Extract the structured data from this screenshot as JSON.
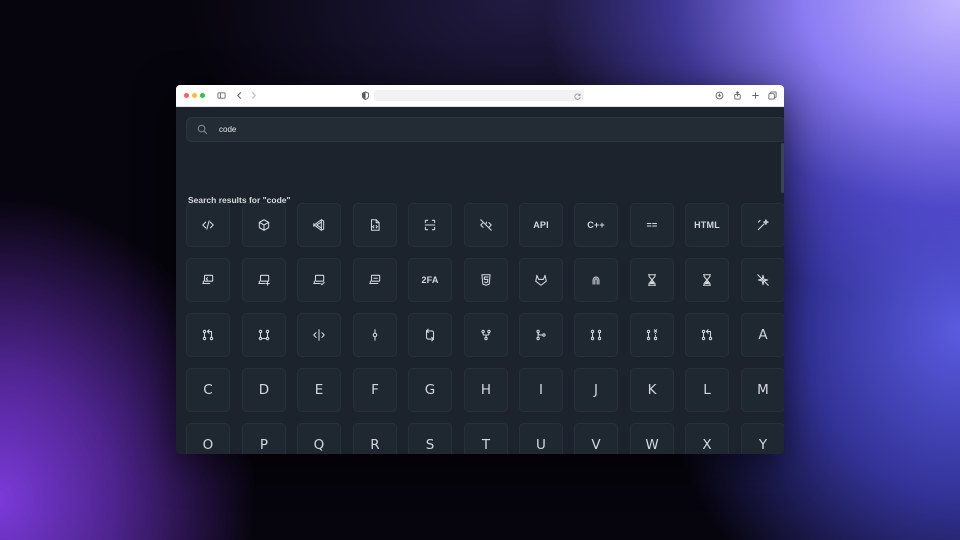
{
  "search": {
    "value": "code"
  },
  "results_title": "Search results for \"code\"",
  "rows": [
    [
      {
        "name": "code-icon",
        "icon": "code"
      },
      {
        "name": "cube-code-icon",
        "icon": "cube"
      },
      {
        "name": "vscode-icon",
        "icon": "vscode"
      },
      {
        "name": "file-code-icon",
        "icon": "file"
      },
      {
        "name": "scan-code-icon",
        "icon": "scan"
      },
      {
        "name": "code-off-icon",
        "icon": "codeoff"
      },
      {
        "name": "api-icon",
        "text": "API"
      },
      {
        "name": "cplusplus-icon",
        "text": "C++"
      },
      {
        "name": "equal-double-icon",
        "text": "=="
      },
      {
        "name": "html-icon",
        "text": "HTML"
      },
      {
        "name": "wand-sparkle-icon",
        "icon": "wand"
      }
    ],
    [
      {
        "name": "device-code-icon",
        "icon": "laptop"
      },
      {
        "name": "device-code-plus-icon",
        "icon": "laptop2"
      },
      {
        "name": "device-code-check-icon",
        "icon": "laptop3"
      },
      {
        "name": "device-code-alt-icon",
        "icon": "laptop4"
      },
      {
        "name": "2fa-icon",
        "text": "2FA"
      },
      {
        "name": "brand-html5-icon",
        "icon": "html5"
      },
      {
        "name": "brand-gitlab-icon",
        "icon": "gitlab"
      },
      {
        "name": "brand-openai-icon",
        "icon": "open"
      },
      {
        "name": "hourglass-icon",
        "icon": "hourglass"
      },
      {
        "name": "hourglass-alt-icon",
        "icon": "hourglass"
      },
      {
        "name": "sparkle-off-icon",
        "icon": "sparkoff"
      }
    ],
    [
      {
        "name": "git-pull-request-icon",
        "icon": "gitpr"
      },
      {
        "name": "git-compare-icon",
        "icon": "gitpr2"
      },
      {
        "name": "source-code-icon",
        "icon": "srccode"
      },
      {
        "name": "git-commit-icon",
        "icon": "commit"
      },
      {
        "name": "git-branch-swap-icon",
        "icon": "swap"
      },
      {
        "name": "git-fork-icon",
        "icon": "fork"
      },
      {
        "name": "git-merge-icon",
        "icon": "merge"
      },
      {
        "name": "git-pull-request-draft-icon",
        "icon": "prdraft"
      },
      {
        "name": "git-pull-request-closed-icon",
        "icon": "prclosed"
      },
      {
        "name": "git-cherry-pick-icon",
        "icon": "cherry"
      },
      {
        "name": "letter-a-icon",
        "letter": "A"
      }
    ],
    [
      {
        "name": "letter-c-icon",
        "letter": "C"
      },
      {
        "name": "letter-d-icon",
        "letter": "D"
      },
      {
        "name": "letter-e-icon",
        "letter": "E"
      },
      {
        "name": "letter-f-icon",
        "letter": "F"
      },
      {
        "name": "letter-g-icon",
        "letter": "G"
      },
      {
        "name": "letter-h-icon",
        "letter": "H"
      },
      {
        "name": "letter-i-icon",
        "letter": "I"
      },
      {
        "name": "letter-j-icon",
        "letter": "J"
      },
      {
        "name": "letter-k-icon",
        "letter": "K"
      },
      {
        "name": "letter-l-icon",
        "letter": "L"
      },
      {
        "name": "letter-m-icon",
        "letter": "M"
      }
    ],
    [
      {
        "name": "letter-o-icon",
        "letter": "O"
      },
      {
        "name": "letter-p-icon",
        "letter": "P"
      },
      {
        "name": "letter-q-icon",
        "letter": "Q"
      },
      {
        "name": "letter-r-icon",
        "letter": "R"
      },
      {
        "name": "letter-s-icon",
        "letter": "S"
      },
      {
        "name": "letter-t-icon",
        "letter": "T"
      },
      {
        "name": "letter-u-icon",
        "letter": "U"
      },
      {
        "name": "letter-v-icon",
        "letter": "V"
      },
      {
        "name": "letter-w-icon",
        "letter": "W"
      },
      {
        "name": "letter-x-icon",
        "letter": "X"
      },
      {
        "name": "letter-y-icon",
        "letter": "Y"
      }
    ]
  ]
}
